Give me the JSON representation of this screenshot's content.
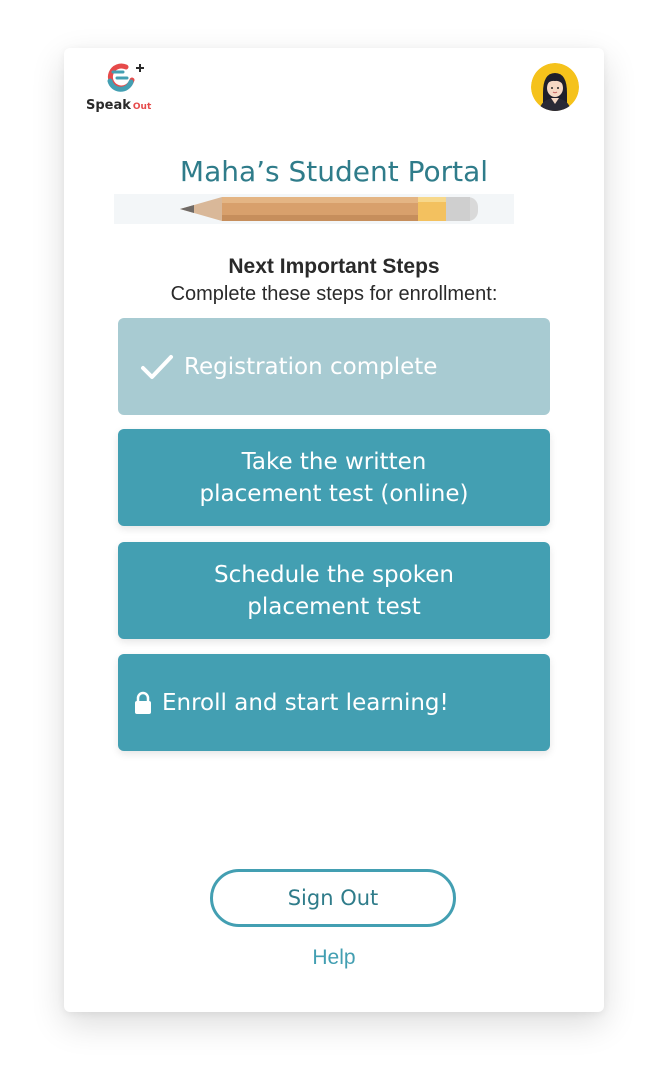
{
  "brand": {
    "name": "Speak",
    "suffix": "Out",
    "logo_icon": "speakout-logo-icon",
    "colors": {
      "teal": "#439fb2",
      "red": "#e64a4a"
    }
  },
  "user": {
    "avatar_icon": "student-avatar-icon"
  },
  "portal": {
    "title": "Maha’s Student Portal"
  },
  "steps": {
    "heading": "Next Important Steps",
    "subheading": "Complete these steps for enrollment:",
    "items": [
      {
        "label": "Registration complete",
        "status": "complete",
        "icon": "check-icon"
      },
      {
        "label_line1": "Take the written",
        "label_line2": "placement test (online)",
        "status": "available"
      },
      {
        "label_line1": "Schedule the spoken",
        "label_line2": "placement test",
        "status": "available"
      },
      {
        "label": "Enroll and start learning!",
        "status": "locked",
        "icon": "lock-icon"
      }
    ]
  },
  "actions": {
    "sign_out": "Sign Out",
    "help": "Help"
  },
  "colors": {
    "primary": "#439fb2",
    "complete": "#a8cbd2",
    "title": "#2f7c8a"
  }
}
